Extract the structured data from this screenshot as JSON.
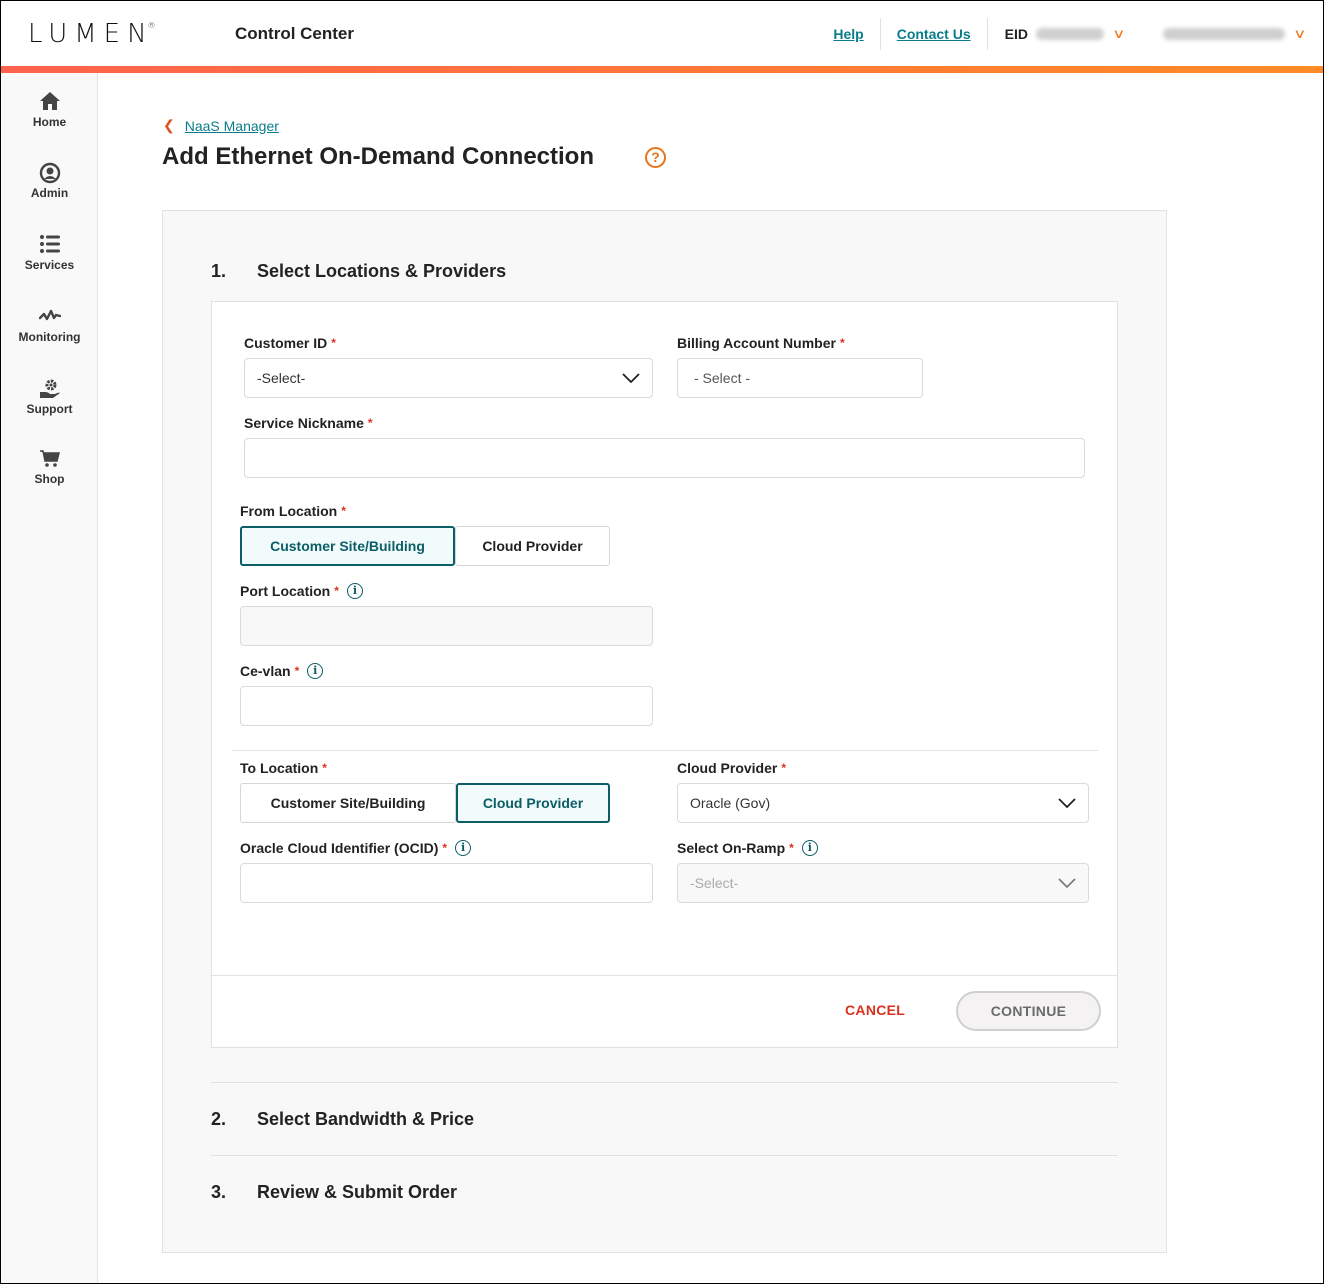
{
  "header": {
    "logo": "LUMEN",
    "app_title": "Control Center",
    "links": [
      "Help",
      "Contact Us"
    ],
    "eid_label": "EID",
    "accent_gradient": [
      "#fe624c",
      "#ff8a26"
    ]
  },
  "sidebar": {
    "items": [
      {
        "label": "Home",
        "icon": "home-icon"
      },
      {
        "label": "Admin",
        "icon": "user-circle-icon"
      },
      {
        "label": "Services",
        "icon": "list-icon"
      },
      {
        "label": "Monitoring",
        "icon": "pulse-icon"
      },
      {
        "label": "Support",
        "icon": "support-gear-icon"
      },
      {
        "label": "Shop",
        "icon": "cart-icon"
      }
    ]
  },
  "breadcrumb": {
    "back_label": "NaaS Manager"
  },
  "page": {
    "title": "Add Ethernet On-Demand Connection",
    "help_glyph": "?"
  },
  "steps": [
    {
      "number": "1.",
      "title": "Select Locations & Providers"
    },
    {
      "number": "2.",
      "title": "Select Bandwidth & Price"
    },
    {
      "number": "3.",
      "title": "Review & Submit Order"
    }
  ],
  "form": {
    "required_mark": "*",
    "info_glyph": "i",
    "customer_id": {
      "label": "Customer ID",
      "value": "-Select-"
    },
    "billing_account": {
      "label": "Billing Account Number",
      "value": "- Select -"
    },
    "service_nickname": {
      "label": "Service Nickname",
      "value": ""
    },
    "from_location": {
      "label": "From Location",
      "options": [
        "Customer Site/Building",
        "Cloud Provider"
      ],
      "selected": "Customer Site/Building"
    },
    "port_location": {
      "label": "Port Location",
      "value": ""
    },
    "ce_vlan": {
      "label": "Ce-vlan",
      "value": ""
    },
    "to_location": {
      "label": "To Location",
      "options": [
        "Customer Site/Building",
        "Cloud Provider"
      ],
      "selected": "Cloud Provider"
    },
    "cloud_provider": {
      "label": "Cloud Provider",
      "value": "Oracle (Gov)"
    },
    "ocid": {
      "label": "Oracle Cloud Identifier (OCID)",
      "value": ""
    },
    "on_ramp": {
      "label": "Select On-Ramp",
      "value": "-Select-"
    },
    "cancel_label": "CANCEL",
    "continue_label": "CONTINUE"
  }
}
